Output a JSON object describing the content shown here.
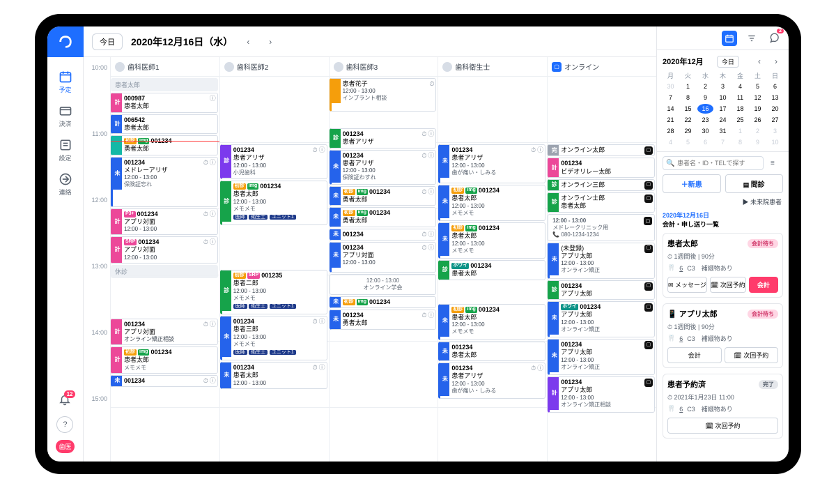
{
  "rail": {
    "items": [
      {
        "icon": "calendar",
        "label": "予定"
      },
      {
        "icon": "payment",
        "label": "決済"
      },
      {
        "icon": "settings",
        "label": "設定"
      },
      {
        "icon": "send",
        "label": "連絡"
      }
    ],
    "bell_badge": "12",
    "role_label": "歯医"
  },
  "topbar": {
    "today": "今日",
    "date": "2020年12月16日（水）"
  },
  "columns": [
    {
      "label": "歯科医師1",
      "type": "person"
    },
    {
      "label": "歯科医師2",
      "type": "person"
    },
    {
      "label": "歯科医師3",
      "type": "person"
    },
    {
      "label": "歯科衛生士",
      "type": "person"
    },
    {
      "label": "オンライン",
      "type": "online"
    }
  ],
  "times": [
    "10:00",
    "11:00",
    "12:00",
    "13:00",
    "14:00",
    "15:00"
  ],
  "col1": {
    "off_top": "患者太郎",
    "a": {
      "status": "計",
      "sq": "pink",
      "id": "000987",
      "nm": "患者太郎",
      "icons": [
        "ⓘ"
      ]
    },
    "b": {
      "status": "計",
      "sq": "blue",
      "id": "006542",
      "nm": "患者太郎"
    },
    "c": {
      "tags": [
        "初診",
        "img"
      ],
      "sq": "teal",
      "id": "001234",
      "nm": "勇者太郎"
    },
    "d": {
      "status": "未",
      "sq": "blue",
      "id": "001234",
      "nm": "メドレーアリザ",
      "tm": "12:00 - 13:00",
      "mm": "保険証忘れ",
      "icons": [
        "⏱",
        "ⓘ"
      ]
    },
    "e": {
      "status": "計",
      "sq": "pink",
      "tag": "P3+",
      "id": "001234",
      "nm": "アプリ対面",
      "tm": "12:00 - 13:00",
      "icons": [
        "⏱",
        "ⓘ"
      ]
    },
    "f": {
      "status": "計",
      "sq": "pink",
      "tag": "SRP",
      "id": "001234",
      "nm": "アプリ対面",
      "tm": "12:00 - 13:00",
      "icons": [
        "⏱",
        "ⓘ"
      ]
    },
    "off_mid": "休診",
    "g": {
      "status": "計",
      "sq": "pink",
      "id": "001234",
      "nm": "アプリ対面",
      "tm": "オンライン矯正相談",
      "icons": [
        "⏱",
        "ⓘ"
      ]
    },
    "h": {
      "status": "計",
      "sq": "pink",
      "tags": [
        "初診",
        "img"
      ],
      "id": "001234",
      "nm": "患者太郎",
      "mm": "メモメモ"
    },
    "i": {
      "status": "未",
      "sq": "blue",
      "id": "001234",
      "icons": [
        "⏱",
        "ⓘ"
      ]
    }
  },
  "col2": {
    "a": {
      "status": "診",
      "sq": "purple",
      "id": "001234",
      "nm": "患者アリザ",
      "tm": "12:00 - 13:00",
      "mm": "小児歯科",
      "icons": [
        "⏱",
        "ⓘ"
      ]
    },
    "b": {
      "status": "診",
      "sq": "green",
      "tags": [
        "初診",
        "img"
      ],
      "id": "001234",
      "nm": "患者太郎",
      "tm": "12:00 - 13:00",
      "mm": "メモメモ",
      "units": [
        "医師",
        "衛生士",
        "ユニット1"
      ]
    },
    "c": {
      "status": "診",
      "sq": "green",
      "tags": [
        "初診",
        "SRP"
      ],
      "id": "001235",
      "nm": "患者二郎",
      "tm": "12:00 - 13:00",
      "mm": "メモメモ",
      "units": [
        "医師",
        "衛生士",
        "ユニット1"
      ]
    },
    "d": {
      "status": "未",
      "sq": "blue",
      "id": "001234",
      "nm": "患者三郎",
      "tm": "12:00 - 13:00",
      "mm": "メモメモ",
      "units": [
        "医師",
        "衛生士",
        "ユニット1"
      ],
      "icons": [
        "⏱",
        "ⓘ"
      ]
    },
    "e": {
      "status": "未",
      "sq": "blue",
      "id": "001234",
      "nm": "患者太郎",
      "tm": "12:00 - 13:00",
      "icons": [
        "⏱",
        "ⓘ"
      ]
    }
  },
  "col3": {
    "a": {
      "sq": "orange",
      "nm": "患者花子",
      "tm": "12:00 - 13:00",
      "mm": "インプラント相談",
      "icons": [
        "⏱"
      ]
    },
    "b": {
      "status": "診",
      "sq": "green",
      "id": "001234",
      "nm": "患者アリザ",
      "icons": [
        "⏱",
        "ⓘ"
      ]
    },
    "c": {
      "status": "未",
      "sq": "blue",
      "id": "001234",
      "nm": "患者アリザ",
      "tm": "12:00 - 13:00",
      "mm": "保険証わすれ",
      "icons": [
        "⏱",
        "ⓘ"
      ]
    },
    "d": {
      "status": "未",
      "sq": "blue",
      "tags": [
        "初診",
        "img"
      ],
      "id": "001234",
      "nm": "勇者太郎",
      "icons": [
        "⏱",
        "ⓘ"
      ]
    },
    "d2": {
      "status": "未",
      "sq": "blue",
      "tags": [
        "初診",
        "img"
      ],
      "id": "001234",
      "nm": "勇者太郎"
    },
    "e": {
      "status": "未",
      "sq": "blue",
      "id": "001234",
      "icons": [
        "⏱",
        "ⓘ"
      ]
    },
    "f": {
      "status": "未",
      "sq": "blue",
      "id": "001234",
      "nm": "アプリ対面",
      "tm": "12:00 - 13:00",
      "icons": [
        "⏱",
        "ⓘ"
      ]
    },
    "free": {
      "tm": "12:00 - 13:00",
      "nm": "オンライン学会"
    },
    "g": {
      "status": "未",
      "sq": "blue",
      "tags": [
        "初診",
        "img"
      ],
      "id": "001234"
    },
    "h": {
      "status": "未",
      "sq": "blue",
      "id": "001234",
      "nm": "勇者太郎",
      "icons": [
        "⏱",
        "ⓘ"
      ]
    }
  },
  "col4": {
    "a": {
      "status": "未",
      "sq": "blue",
      "id": "001234",
      "nm": "患者アリザ",
      "tm": "12:00 - 13:00",
      "mm": "歯が痛い・しみる",
      "icons": [
        "⏱",
        "ⓘ"
      ]
    },
    "b": {
      "status": "未",
      "sq": "blue",
      "tags": [
        "初診",
        "img"
      ],
      "id": "001234",
      "nm": "患者太郎",
      "tm": "12:00 - 13:00",
      "mm": "メモメモ"
    },
    "b2": {
      "status": "未",
      "sq": "blue",
      "tags": [
        "初診",
        "img"
      ],
      "id": "001234",
      "nm": "患者太郎",
      "tm": "12:00 - 13:00",
      "mm": "メモメモ"
    },
    "c": {
      "status": "診",
      "sq": "green",
      "tag": "ホワイ",
      "id": "001234",
      "nm": "患者太郎"
    },
    "d": {
      "status": "未",
      "sq": "blue",
      "tags": [
        "初診",
        "img"
      ],
      "id": "001234",
      "nm": "患者太郎",
      "tm": "12:00 - 13:00",
      "mm": "メモメモ"
    },
    "e": {
      "status": "未",
      "sq": "blue",
      "id": "001234",
      "nm": "患者太郎"
    },
    "f": {
      "status": "未",
      "sq": "blue",
      "id": "001234",
      "nm": "患者アリザ",
      "tm": "12:00 - 13:00",
      "mm": "歯が痛い・しみる",
      "icons": [
        "⏱",
        "ⓘ"
      ]
    }
  },
  "col5": {
    "a": {
      "status": "完",
      "sq": "gray",
      "nm": "オンライン太郎",
      "oc": true
    },
    "b": {
      "status": "計",
      "sq": "pink",
      "id": "001234",
      "nm": "ビデオリレー太郎"
    },
    "c": {
      "status": "診",
      "sq": "green",
      "nm": "オンライン三郎",
      "oc": true
    },
    "d": {
      "status": "診",
      "sq": "green",
      "nm": "オンライン士郎",
      "nm2": "患者太郎",
      "oc": true
    },
    "free": {
      "tm": "12:00 - 13:00",
      "mm": "メドレークリニック用",
      "tel": "080-1234-1234"
    },
    "e": {
      "status": "未",
      "sq": "blue",
      "nm": "(未登録)",
      "nm2": "アプリ太郎",
      "tm": "12:00 - 13:00",
      "mm": "オンライン矯正",
      "oc": true
    },
    "f": {
      "status": "診",
      "sq": "green",
      "id": "001234",
      "nm": "アプリ太郎",
      "oc": true
    },
    "g": {
      "status": "未",
      "sq": "blue",
      "tag": "ホワイ",
      "id": "001234",
      "nm": "アプリ太郎",
      "tm": "12:00 - 13:00",
      "mm": "オンライン矯正",
      "oc": true
    },
    "h": {
      "status": "未",
      "sq": "blue",
      "id": "001234",
      "nm": "アプリ太郎",
      "tm": "12:00 - 13:00",
      "mm": "オンライン矯正",
      "oc": true
    },
    "i": {
      "status": "計",
      "sq": "purple",
      "id": "001234",
      "nm": "アプリ太郎",
      "tm": "12:00 - 13:00",
      "mm": "オンライン矯正相談",
      "oc": true
    }
  },
  "side": {
    "chat_badge": "2",
    "mini": {
      "title": "2020年12月",
      "today": "今日",
      "dh": [
        "月",
        "火",
        "水",
        "木",
        "金",
        "土",
        "日"
      ],
      "rows": [
        [
          [
            "30",
            1
          ],
          [
            "1",
            0
          ],
          [
            "2",
            0
          ],
          [
            "3",
            0
          ],
          [
            "4",
            0
          ],
          [
            "5",
            0
          ],
          [
            "6",
            0
          ]
        ],
        [
          [
            "7",
            0
          ],
          [
            "8",
            0
          ],
          [
            "9",
            0
          ],
          [
            "10",
            0
          ],
          [
            "11",
            0
          ],
          [
            "12",
            0
          ],
          [
            "13",
            0
          ]
        ],
        [
          [
            "14",
            0
          ],
          [
            "15",
            0
          ],
          [
            "16",
            2
          ],
          [
            "17",
            0
          ],
          [
            "18",
            0
          ],
          [
            "19",
            0
          ],
          [
            "20",
            0
          ]
        ],
        [
          [
            "21",
            0
          ],
          [
            "22",
            0
          ],
          [
            "23",
            0
          ],
          [
            "24",
            0
          ],
          [
            "25",
            0
          ],
          [
            "26",
            0
          ],
          [
            "27",
            0
          ]
        ],
        [
          [
            "28",
            0
          ],
          [
            "29",
            0
          ],
          [
            "30",
            0
          ],
          [
            "31",
            0
          ],
          [
            "1",
            1
          ],
          [
            "2",
            1
          ],
          [
            "3",
            1
          ]
        ],
        [
          [
            "4",
            1
          ],
          [
            "5",
            1
          ],
          [
            "6",
            1
          ],
          [
            "7",
            1
          ],
          [
            "8",
            1
          ],
          [
            "9",
            1
          ],
          [
            "10",
            1
          ]
        ]
      ]
    },
    "search_ph": "患者名・ID・TELで探す",
    "btn_new": "＋新患",
    "btn_q": "問診",
    "link": "▶ 未来院患者",
    "list_date": "2020年12月16日",
    "list_title": "会計・申し送り一覧",
    "cards": [
      {
        "name": "患者太郎",
        "chip": "会計待ち",
        "chip_cls": "",
        "m1": "1週間後",
        "m2": "90分",
        "m3": "6",
        "m4": "C3",
        "m5": "補綴物あり",
        "btns": [
          [
            "メッセージ",
            ""
          ],
          [
            "次回予約",
            ""
          ],
          [
            "会計",
            "pink"
          ]
        ],
        "icons": true
      },
      {
        "name": "アプリ太郎",
        "chip": "会計待ち",
        "chip_cls": "",
        "m1": "1週間後",
        "m2": "90分",
        "m3": "6",
        "m4": "C3",
        "m5": "補綴物あり",
        "btns": [
          [
            "会計",
            ""
          ],
          [
            "次回予約",
            ""
          ]
        ],
        "app": true
      },
      {
        "name": "患者予約済",
        "chip": "完了",
        "chip_cls": "done",
        "m1": "2021年1月23日 11:00",
        "m3": "6",
        "m4": "C3",
        "m5": "補綴物あり",
        "btns": [
          [
            "次回予約",
            ""
          ]
        ]
      }
    ]
  }
}
